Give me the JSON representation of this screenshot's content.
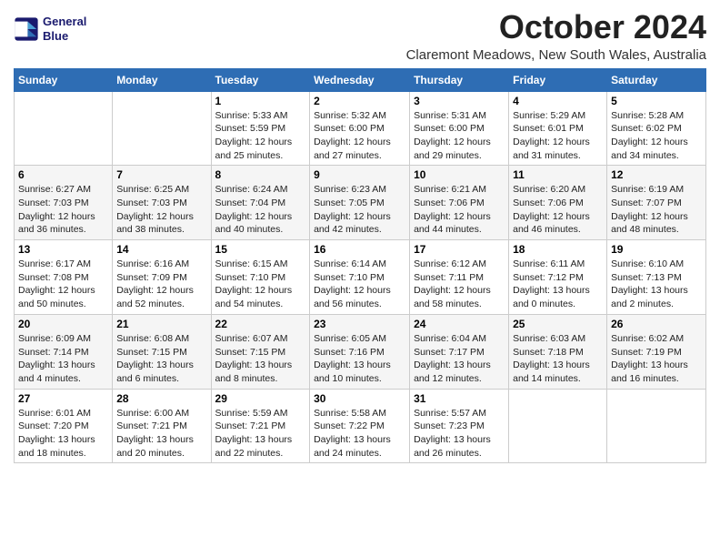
{
  "logo": {
    "line1": "General",
    "line2": "Blue"
  },
  "title": "October 2024",
  "subtitle": "Claremont Meadows, New South Wales, Australia",
  "days_of_week": [
    "Sunday",
    "Monday",
    "Tuesday",
    "Wednesday",
    "Thursday",
    "Friday",
    "Saturday"
  ],
  "weeks": [
    [
      {
        "day": "",
        "content": ""
      },
      {
        "day": "",
        "content": ""
      },
      {
        "day": "1",
        "content": "Sunrise: 5:33 AM\nSunset: 5:59 PM\nDaylight: 12 hours\nand 25 minutes."
      },
      {
        "day": "2",
        "content": "Sunrise: 5:32 AM\nSunset: 6:00 PM\nDaylight: 12 hours\nand 27 minutes."
      },
      {
        "day": "3",
        "content": "Sunrise: 5:31 AM\nSunset: 6:00 PM\nDaylight: 12 hours\nand 29 minutes."
      },
      {
        "day": "4",
        "content": "Sunrise: 5:29 AM\nSunset: 6:01 PM\nDaylight: 12 hours\nand 31 minutes."
      },
      {
        "day": "5",
        "content": "Sunrise: 5:28 AM\nSunset: 6:02 PM\nDaylight: 12 hours\nand 34 minutes."
      }
    ],
    [
      {
        "day": "6",
        "content": "Sunrise: 6:27 AM\nSunset: 7:03 PM\nDaylight: 12 hours\nand 36 minutes."
      },
      {
        "day": "7",
        "content": "Sunrise: 6:25 AM\nSunset: 7:03 PM\nDaylight: 12 hours\nand 38 minutes."
      },
      {
        "day": "8",
        "content": "Sunrise: 6:24 AM\nSunset: 7:04 PM\nDaylight: 12 hours\nand 40 minutes."
      },
      {
        "day": "9",
        "content": "Sunrise: 6:23 AM\nSunset: 7:05 PM\nDaylight: 12 hours\nand 42 minutes."
      },
      {
        "day": "10",
        "content": "Sunrise: 6:21 AM\nSunset: 7:06 PM\nDaylight: 12 hours\nand 44 minutes."
      },
      {
        "day": "11",
        "content": "Sunrise: 6:20 AM\nSunset: 7:06 PM\nDaylight: 12 hours\nand 46 minutes."
      },
      {
        "day": "12",
        "content": "Sunrise: 6:19 AM\nSunset: 7:07 PM\nDaylight: 12 hours\nand 48 minutes."
      }
    ],
    [
      {
        "day": "13",
        "content": "Sunrise: 6:17 AM\nSunset: 7:08 PM\nDaylight: 12 hours\nand 50 minutes."
      },
      {
        "day": "14",
        "content": "Sunrise: 6:16 AM\nSunset: 7:09 PM\nDaylight: 12 hours\nand 52 minutes."
      },
      {
        "day": "15",
        "content": "Sunrise: 6:15 AM\nSunset: 7:10 PM\nDaylight: 12 hours\nand 54 minutes."
      },
      {
        "day": "16",
        "content": "Sunrise: 6:14 AM\nSunset: 7:10 PM\nDaylight: 12 hours\nand 56 minutes."
      },
      {
        "day": "17",
        "content": "Sunrise: 6:12 AM\nSunset: 7:11 PM\nDaylight: 12 hours\nand 58 minutes."
      },
      {
        "day": "18",
        "content": "Sunrise: 6:11 AM\nSunset: 7:12 PM\nDaylight: 13 hours\nand 0 minutes."
      },
      {
        "day": "19",
        "content": "Sunrise: 6:10 AM\nSunset: 7:13 PM\nDaylight: 13 hours\nand 2 minutes."
      }
    ],
    [
      {
        "day": "20",
        "content": "Sunrise: 6:09 AM\nSunset: 7:14 PM\nDaylight: 13 hours\nand 4 minutes."
      },
      {
        "day": "21",
        "content": "Sunrise: 6:08 AM\nSunset: 7:15 PM\nDaylight: 13 hours\nand 6 minutes."
      },
      {
        "day": "22",
        "content": "Sunrise: 6:07 AM\nSunset: 7:15 PM\nDaylight: 13 hours\nand 8 minutes."
      },
      {
        "day": "23",
        "content": "Sunrise: 6:05 AM\nSunset: 7:16 PM\nDaylight: 13 hours\nand 10 minutes."
      },
      {
        "day": "24",
        "content": "Sunrise: 6:04 AM\nSunset: 7:17 PM\nDaylight: 13 hours\nand 12 minutes."
      },
      {
        "day": "25",
        "content": "Sunrise: 6:03 AM\nSunset: 7:18 PM\nDaylight: 13 hours\nand 14 minutes."
      },
      {
        "day": "26",
        "content": "Sunrise: 6:02 AM\nSunset: 7:19 PM\nDaylight: 13 hours\nand 16 minutes."
      }
    ],
    [
      {
        "day": "27",
        "content": "Sunrise: 6:01 AM\nSunset: 7:20 PM\nDaylight: 13 hours\nand 18 minutes."
      },
      {
        "day": "28",
        "content": "Sunrise: 6:00 AM\nSunset: 7:21 PM\nDaylight: 13 hours\nand 20 minutes."
      },
      {
        "day": "29",
        "content": "Sunrise: 5:59 AM\nSunset: 7:21 PM\nDaylight: 13 hours\nand 22 minutes."
      },
      {
        "day": "30",
        "content": "Sunrise: 5:58 AM\nSunset: 7:22 PM\nDaylight: 13 hours\nand 24 minutes."
      },
      {
        "day": "31",
        "content": "Sunrise: 5:57 AM\nSunset: 7:23 PM\nDaylight: 13 hours\nand 26 minutes."
      },
      {
        "day": "",
        "content": ""
      },
      {
        "day": "",
        "content": ""
      }
    ]
  ]
}
